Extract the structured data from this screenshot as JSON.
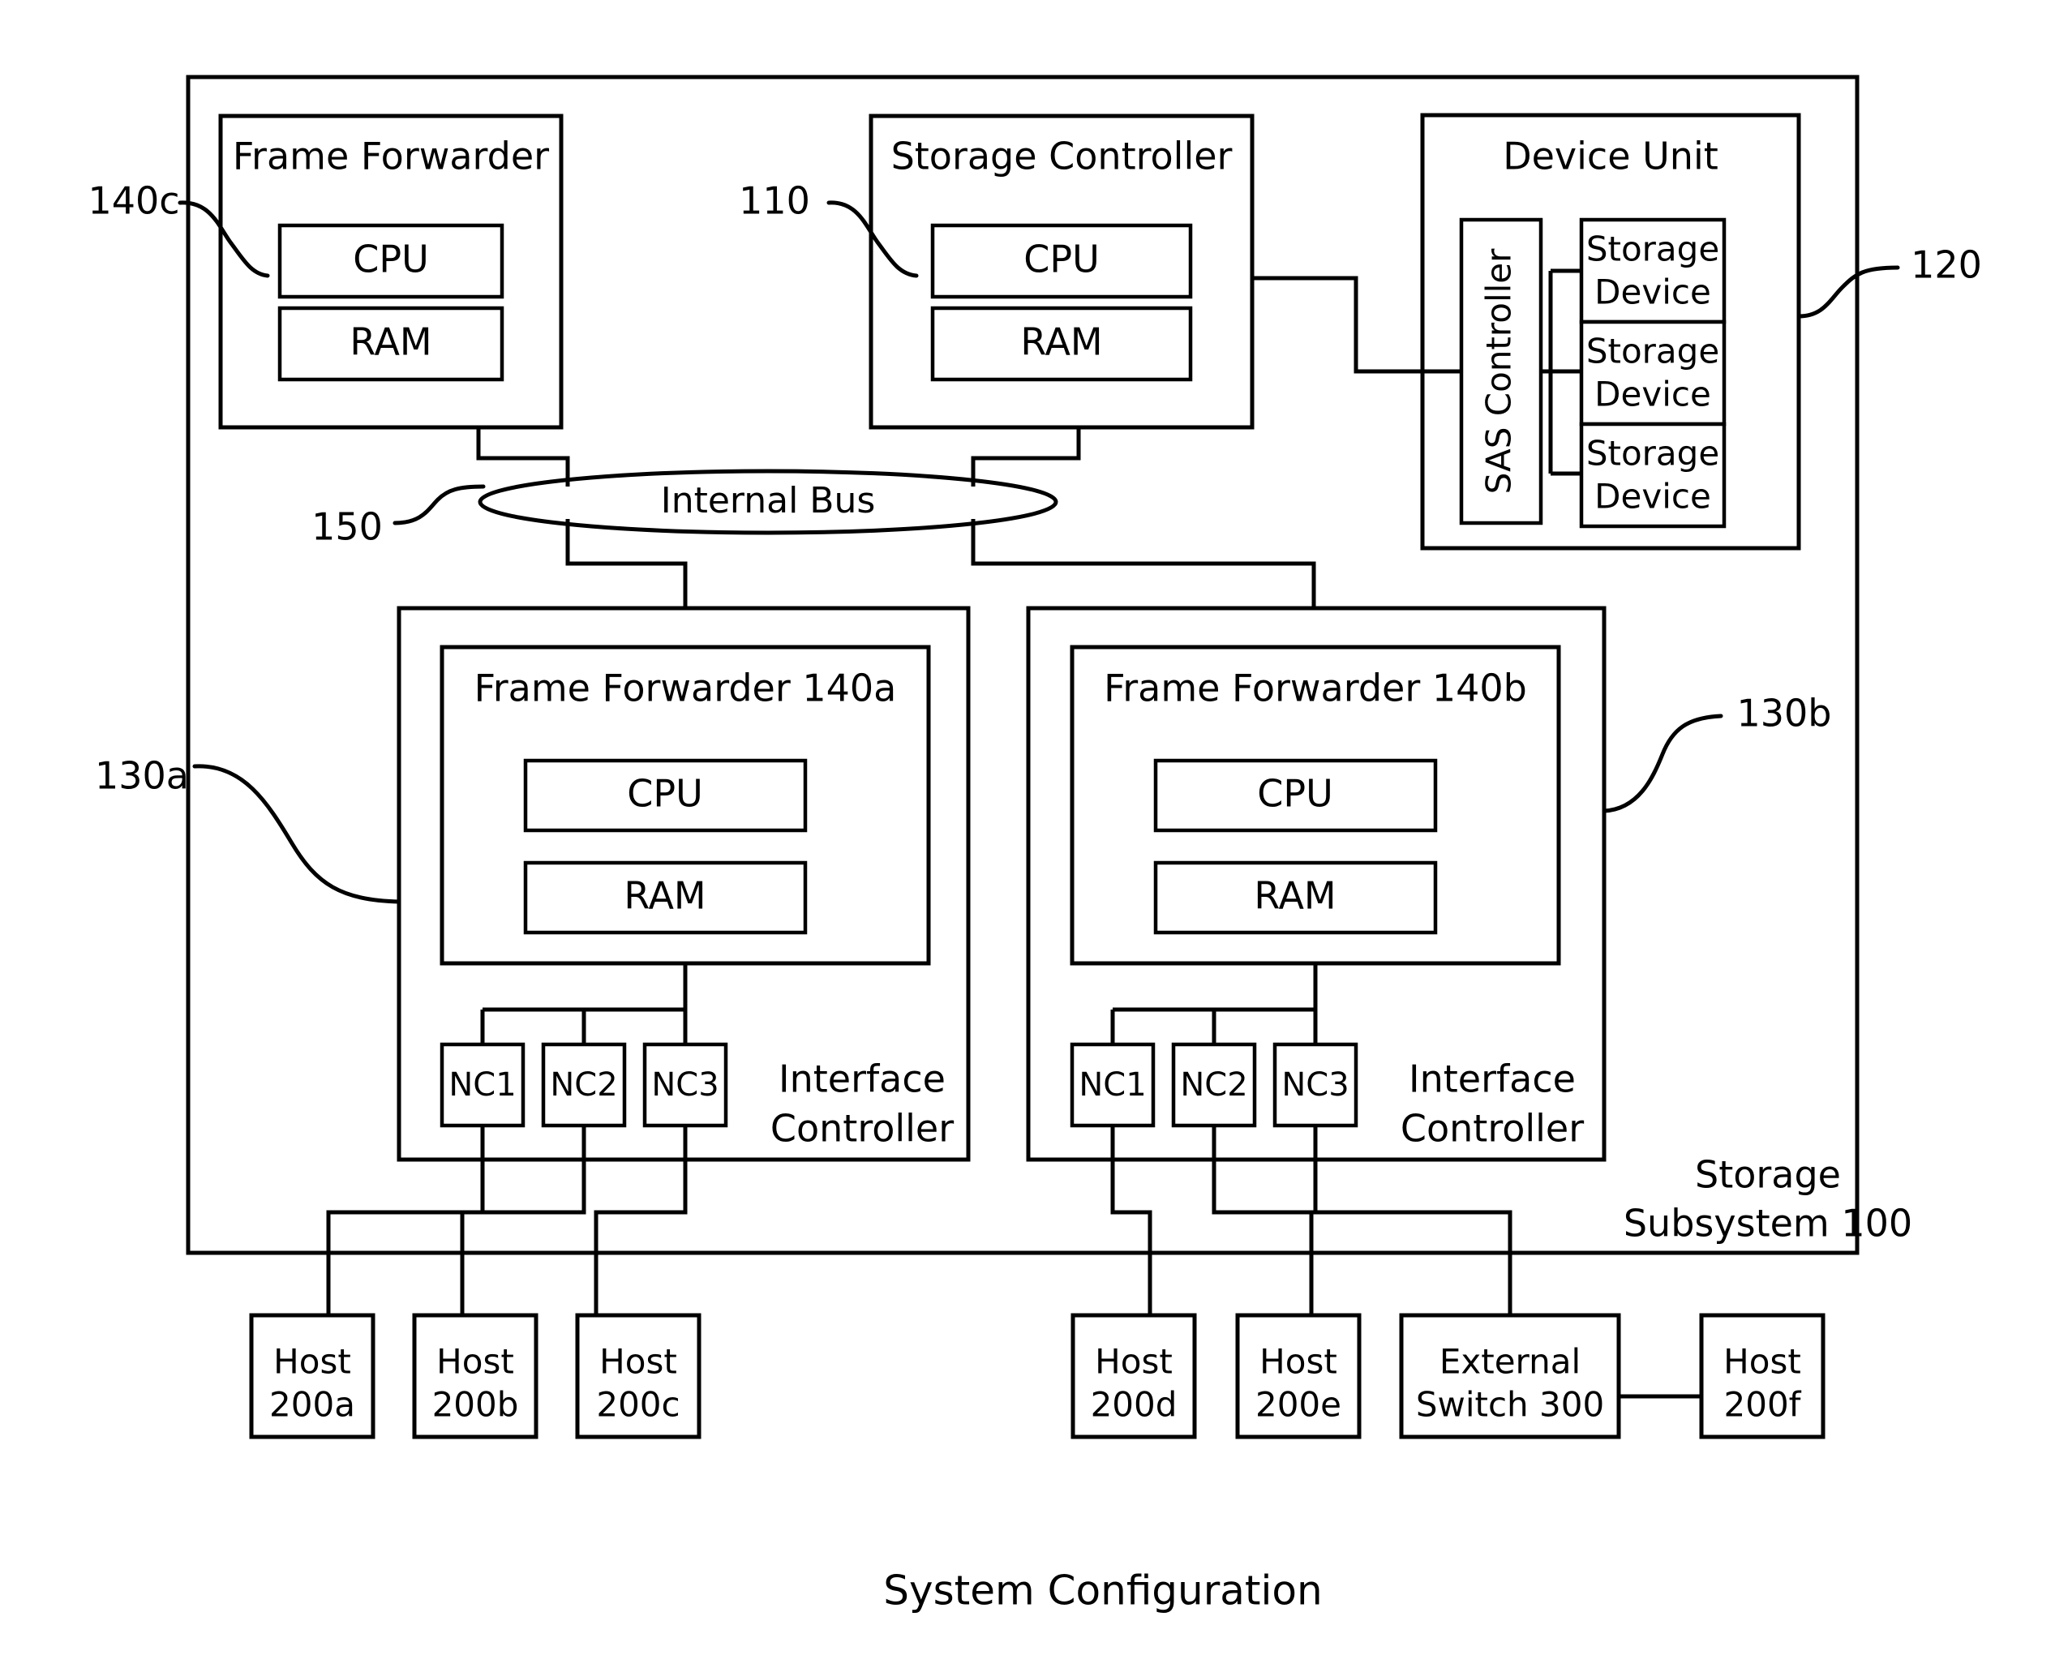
{
  "caption": "System Configuration",
  "subsystem": {
    "label_line1": "Storage",
    "label_line2": "Subsystem 100"
  },
  "top_row": {
    "frame_forwarder_140c": {
      "title": "Frame Forwarder",
      "cpu": "CPU",
      "ram": "RAM",
      "ref": "140c"
    },
    "storage_controller": {
      "title": "Storage Controller",
      "cpu": "CPU",
      "ram": "RAM",
      "ref": "110"
    },
    "device_unit": {
      "title": "Device Unit",
      "sas_controller": "SAS Controller",
      "storage_devices": [
        {
          "line1": "Storage",
          "line2": "Device"
        },
        {
          "line1": "Storage",
          "line2": "Device"
        },
        {
          "line1": "Storage",
          "line2": "Device"
        }
      ],
      "ref": "120"
    }
  },
  "internal_bus": {
    "label": "Internal Bus",
    "ref": "150"
  },
  "interface_controllers": [
    {
      "ref": "130a",
      "frame_forwarder_title": "Frame Forwarder 140a",
      "cpu": "CPU",
      "ram": "RAM",
      "nics": [
        "NC1",
        "NC2",
        "NC3"
      ],
      "label_line1": "Interface",
      "label_line2": "Controller"
    },
    {
      "ref": "130b",
      "frame_forwarder_title": "Frame Forwarder 140b",
      "cpu": "CPU",
      "ram": "RAM",
      "nics": [
        "NC1",
        "NC2",
        "NC3"
      ],
      "label_line1": "Interface",
      "label_line2": "Controller"
    }
  ],
  "hosts": [
    {
      "line1": "Host",
      "line2": "200a"
    },
    {
      "line1": "Host",
      "line2": "200b"
    },
    {
      "line1": "Host",
      "line2": "200c"
    },
    {
      "line1": "Host",
      "line2": "200d"
    },
    {
      "line1": "Host",
      "line2": "200e"
    },
    {
      "line1": "Host",
      "line2": "200f"
    }
  ],
  "external_switch": {
    "line1": "External",
    "line2": "Switch 300"
  },
  "colors": {
    "stroke": "#000000",
    "background": "#ffffff"
  }
}
